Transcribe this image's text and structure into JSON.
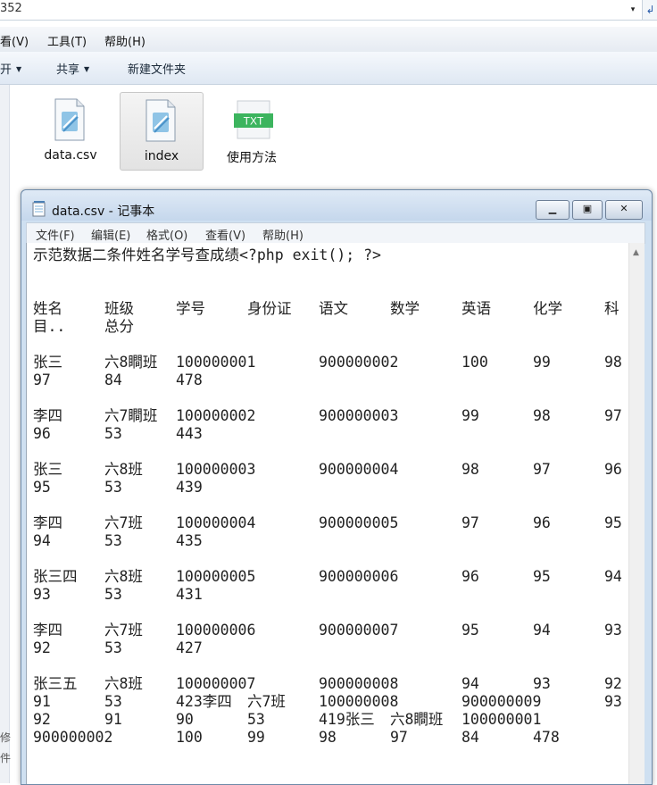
{
  "explorer": {
    "address_fragment": "352",
    "address_dropdown": "▾",
    "address_refresh": "↲",
    "menu": [
      "看(V)",
      "工具(T)",
      "帮助(H)"
    ],
    "toolbar": {
      "open_fragment": "开",
      "share": "共享",
      "new_folder": "新建文件夹"
    },
    "left_fragments": [
      "修",
      "件"
    ],
    "files": [
      {
        "name": "data.csv",
        "icon": "notepad-doc-icon",
        "selected": false
      },
      {
        "name": "index",
        "icon": "notepad-doc-icon",
        "selected": true
      },
      {
        "name": "使用方法",
        "icon": "txt-file-icon",
        "selected": false,
        "badge": "TXT"
      }
    ]
  },
  "notepad": {
    "title": "data.csv - 记事本",
    "menu": [
      "文件(F)",
      "编辑(E)",
      "格式(O)",
      "查看(V)",
      "帮助(H)"
    ],
    "header_line": "示范数据二条件姓名学号查成绩<?php exit(); ?>",
    "header_row_1": [
      "姓名",
      "班级",
      "学号",
      "身份证",
      "语文",
      "数学",
      "英语",
      "化学",
      "科"
    ],
    "header_row_2": [
      "目..",
      "总分"
    ],
    "rows": [
      {
        "a": [
          "张三",
          "六8瞷班",
          "100000001",
          "",
          "900000002",
          "",
          "100",
          "99",
          "98"
        ],
        "b": [
          "97",
          "84",
          "478"
        ]
      },
      {
        "a": [
          "李四",
          "六7瞷班",
          "100000002",
          "",
          "900000003",
          "",
          "99",
          "98",
          "97"
        ],
        "b": [
          "96",
          "53",
          "443"
        ]
      },
      {
        "a": [
          "张三",
          "六8班",
          "100000003",
          "",
          "900000004",
          "",
          "98",
          "97",
          "96"
        ],
        "b": [
          "95",
          "53",
          "439"
        ]
      },
      {
        "a": [
          "李四",
          "六7班",
          "100000004",
          "",
          "900000005",
          "",
          "97",
          "96",
          "95"
        ],
        "b": [
          "94",
          "53",
          "435"
        ]
      },
      {
        "a": [
          "张三四",
          "六8班",
          "100000005",
          "",
          "900000006",
          "",
          "96",
          "95",
          "94"
        ],
        "b": [
          "93",
          "53",
          "431"
        ]
      },
      {
        "a": [
          "李四",
          "六7班",
          "100000006",
          "",
          "900000007",
          "",
          "95",
          "94",
          "93"
        ],
        "b": [
          "92",
          "53",
          "427"
        ]
      }
    ],
    "tail": [
      [
        "张三五",
        "六8班",
        "100000007",
        "",
        "900000008",
        "",
        "94",
        "93",
        "92"
      ],
      [
        "91",
        "53",
        "423李四",
        "六7班",
        "100000008",
        "",
        "900000009",
        "",
        "93"
      ],
      [
        "92",
        "91",
        "90",
        "53",
        "419张三",
        "六8瞷班",
        "100000001",
        "",
        ""
      ],
      [
        "900000002",
        "",
        "100",
        "99",
        "98",
        "97",
        "84",
        "478",
        ""
      ]
    ]
  }
}
